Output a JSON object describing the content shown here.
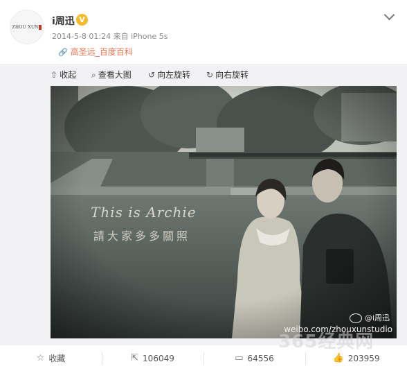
{
  "post": {
    "avatar_text": "ZHOU XUN",
    "username": "i周迅",
    "verified_badge": "V",
    "meta": "2014-5-8 01:24 来自 iPhone 5s",
    "link_label": "高圣远_百度百科",
    "icons": {
      "link": "link-icon",
      "menu": "chevron-down-icon",
      "verified": "verified-badge-icon"
    }
  },
  "media_toolbar": {
    "collapse": "收起",
    "view_large": "查看大图",
    "rotate_left": "向左旋转",
    "rotate_right": "向右旋转"
  },
  "photo": {
    "overlay_title": "This is Archie",
    "overlay_subtitle": "請大家多多關照",
    "watermark_handle": "@i周迅",
    "watermark_url": "weibo.com/zhouxunstudio"
  },
  "actions": {
    "favorite": "收藏",
    "repost": "106049",
    "comment": "64556",
    "like": "203959"
  },
  "site_watermark": "365经典网",
  "colors": {
    "link": "#eb7350",
    "verified": "#f7ba2a",
    "media_bg": "#f2f2f5"
  }
}
